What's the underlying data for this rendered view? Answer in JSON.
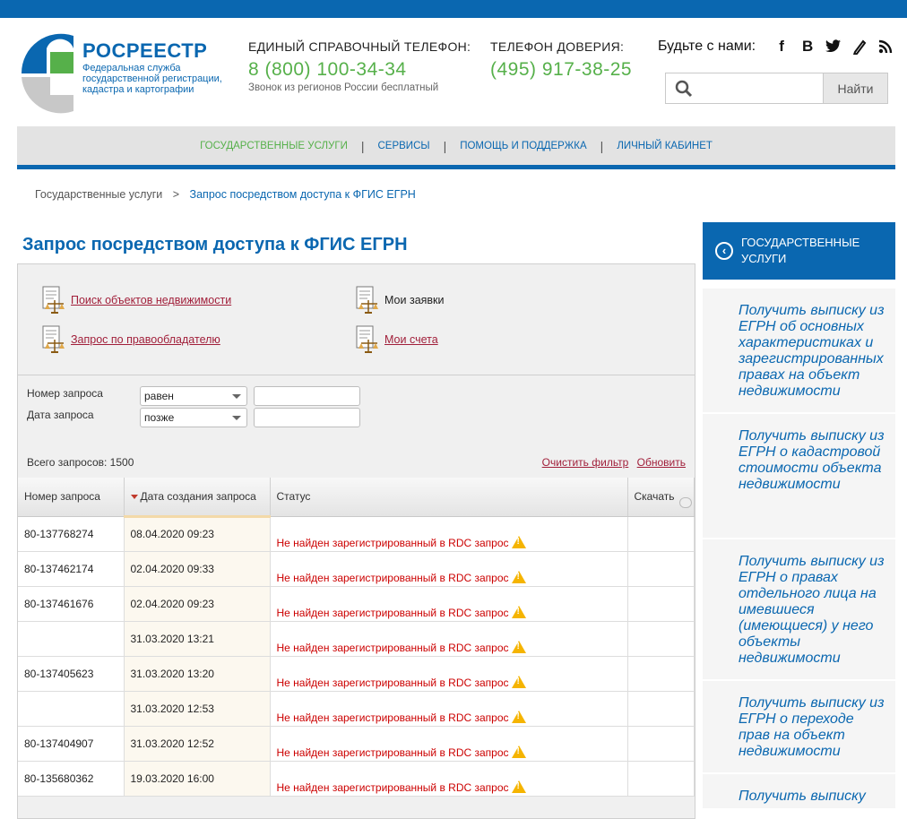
{
  "header": {
    "brand_name": "РОСРЕЕСТР",
    "brand_sub": "Федеральная служба государственной регистрации, кадастра и картографии",
    "phone1_label": "ЕДИНЫЙ СПРАВОЧНЫЙ ТЕЛЕФОН:",
    "phone1_number": "8 (800) 100-34-34",
    "phone1_note": "Звонок из регионов России бесплатный",
    "phone2_label": "ТЕЛЕФОН ДОВЕРИЯ:",
    "phone2_number": "(495) 917-38-25",
    "social_label": "Будьте с нами:",
    "social_icons": [
      "facebook-icon",
      "vk-icon",
      "twitter-icon",
      "blog-icon",
      "rss-icon"
    ],
    "search_placeholder": "",
    "search_button": "Найти"
  },
  "nav": {
    "items": [
      "ГОСУДАРСТВЕННЫЕ УСЛУГИ",
      "СЕРВИСЫ",
      "ПОМОЩЬ И ПОДДЕРЖКА",
      "ЛИЧНЫЙ КАБИНЕТ"
    ],
    "active_index": 0
  },
  "breadcrumb": {
    "parent": "Государственные услуги",
    "separator": ">",
    "current": "Запрос посредством доступа к ФГИС ЕГРН"
  },
  "page_title": "Запрос посредством доступа к ФГИС ЕГРН",
  "links": {
    "search_objects": "Поиск объектов недвижимости",
    "my_requests": "Мои заявки",
    "by_owner": "Запрос по правообладателю",
    "my_bills": "Мои счета"
  },
  "filter": {
    "number_label": "Номер запроса",
    "number_op": "равен",
    "number_value": "",
    "date_label": "Дата запроса",
    "date_op": "позже",
    "date_value": ""
  },
  "summary": {
    "total_label": "Всего запросов: 1500",
    "clear_filter": "Очистить фильтр",
    "refresh": "Обновить"
  },
  "table": {
    "columns": [
      "Номер запроса",
      "Дата создания запроса",
      "Статус",
      "Скачать"
    ],
    "rows": [
      {
        "number": "80-137768274",
        "date": "08.04.2020 09:23",
        "status": "Не найден зарегистрированный в RDC запрос"
      },
      {
        "number": "80-137462174",
        "date": "02.04.2020 09:33",
        "status": "Не найден зарегистрированный в RDC запрос"
      },
      {
        "number": "80-137461676",
        "date": "02.04.2020 09:23",
        "status": "Не найден зарегистрированный в RDC запрос"
      },
      {
        "number": "",
        "date": "31.03.2020 13:21",
        "status": "Не найден зарегистрированный в RDC запрос"
      },
      {
        "number": "80-137405623",
        "date": "31.03.2020 13:20",
        "status": "Не найден зарегистрированный в RDC запрос"
      },
      {
        "number": "",
        "date": "31.03.2020 12:53",
        "status": "Не найден зарегистрированный в RDC запрос"
      },
      {
        "number": "80-137404907",
        "date": "31.03.2020 12:52",
        "status": "Не найден зарегистрированный в RDC запрос"
      },
      {
        "number": "80-135680362",
        "date": "19.03.2020 16:00",
        "status": "Не найден зарегистрированный в RDC запрос"
      }
    ]
  },
  "sidebar": {
    "title": "ГОСУДАРСТВЕННЫЕ УСЛУГИ",
    "items": [
      "Получить выписку из ЕГРН об основных характеристиках и зарегистрированных правах на объект недвижимости",
      "Получить выписку из ЕГРН о кадастровой стоимости объекта недвижимости",
      "Получить выписку из ЕГРН о правах отдельного лица на имевшиеся (имеющиеся) у него объекты недвижимости",
      "Получить выписку из ЕГРН о переходе прав на объект недвижимости",
      "Получить выписку"
    ]
  },
  "colors": {
    "brand_blue": "#0a67b0",
    "accent_green": "#56b04a",
    "link_red": "#a11f3a",
    "status_red": "#cc0000"
  }
}
